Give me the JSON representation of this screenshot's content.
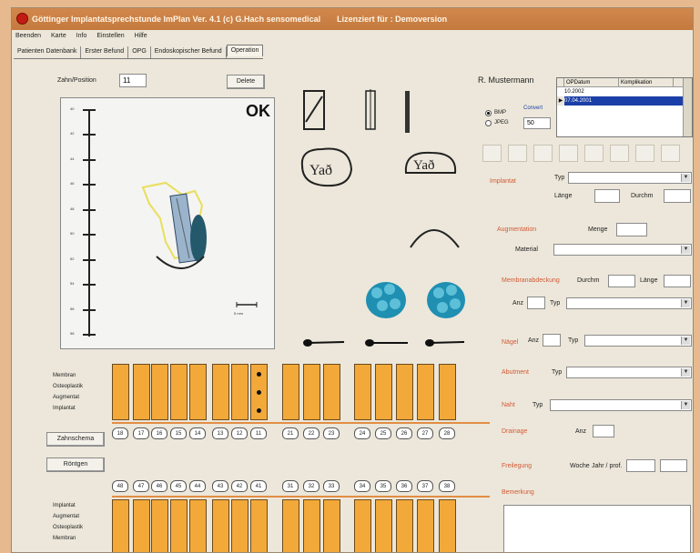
{
  "window": {
    "title": "Göttinger Implantatsprechstunde  ImPlan  Ver. 4.1 (c) G.Hach sensomedical",
    "license": "Lizenziert für : Demoversion"
  },
  "menu": [
    "Beenden",
    "Karte",
    "Info",
    "Einstellen",
    "Hilfe"
  ],
  "tabs": [
    "Patienten Datenbank",
    "Erster Befund",
    "OPG",
    "Endoskopischer Befund",
    "Operation"
  ],
  "active_tab": "Operation",
  "top": {
    "zahn_label": "Zahn/Position",
    "zahn_value": "11",
    "delete_label": "Delete",
    "ok_text": "OK",
    "patient_name": "R. Mustermann"
  },
  "xray": {
    "ruler_labels": [
      "40",
      "42",
      "44",
      "46",
      "48",
      "50",
      "52",
      "54",
      "56",
      "58"
    ],
    "scale_label": "5 mm"
  },
  "format": {
    "bmp_label": "BMP",
    "jpeg_label": "JPEG",
    "convert_label": "Convert",
    "quality_value": "50"
  },
  "op_table": {
    "headers": [
      "OPDatum",
      "Komplikation"
    ],
    "rows": [
      {
        "marker": "",
        "date": "10.2002",
        "note": ""
      },
      {
        "marker": "▶",
        "date": "07.04.2001",
        "note": ""
      },
      {
        "marker": "",
        "date": "",
        "note": ""
      },
      {
        "marker": "",
        "date": "",
        "note": ""
      },
      {
        "marker": "",
        "date": "",
        "note": ""
      }
    ],
    "selected_row": 1
  },
  "form": {
    "implantat_label": "Implantat",
    "typ_label": "Typ",
    "laenge_label": "Länge",
    "durchm_label": "Durchm",
    "augmentation_label": "Augmentation",
    "menge_label": "Menge",
    "material_label": "Material",
    "membran_label": "Membranabdeckung",
    "durchm2_label": "Durchm",
    "laenge2_label": "Länge",
    "anz_label": "Anz",
    "typ2_label": "Typ",
    "nagel_label": "Nägel",
    "anz2_label": "Anz",
    "typ3_label": "Typ",
    "abutment_label": "Abutment",
    "typ4_label": "Typ",
    "naht_label": "Naht",
    "typ5_label": "Typ",
    "drainage_label": "Drainage",
    "anz3_label": "Anz",
    "freilegung_label": "Freilegung",
    "woche_label": "Woche",
    "jahr_label": "Jahr / prof.",
    "bemerkung_label": "Bemerkung"
  },
  "rows_left": {
    "upper": [
      "Membran",
      "Osteoplastik",
      "Augmentat",
      "Implantat"
    ],
    "lower": [
      "Implantat",
      "Augmentat",
      "Osteoplastik",
      "Membran"
    ],
    "buttons": [
      "Zahnschema",
      "Röntgen"
    ]
  },
  "teeth_upper": [
    "18",
    "17",
    "16",
    "15",
    "14",
    "13",
    "12",
    "11",
    "21",
    "22",
    "23",
    "24",
    "25",
    "26",
    "27",
    "28"
  ],
  "teeth_lower": [
    "48",
    "47",
    "46",
    "45",
    "44",
    "43",
    "42",
    "41",
    "31",
    "32",
    "33",
    "34",
    "35",
    "36",
    "37",
    "38"
  ],
  "colors": {
    "accent": "#d35a36",
    "tooth_fill": "#f2a93a",
    "title_bar": "#c47a3e",
    "selection": "#1b3fa8"
  }
}
